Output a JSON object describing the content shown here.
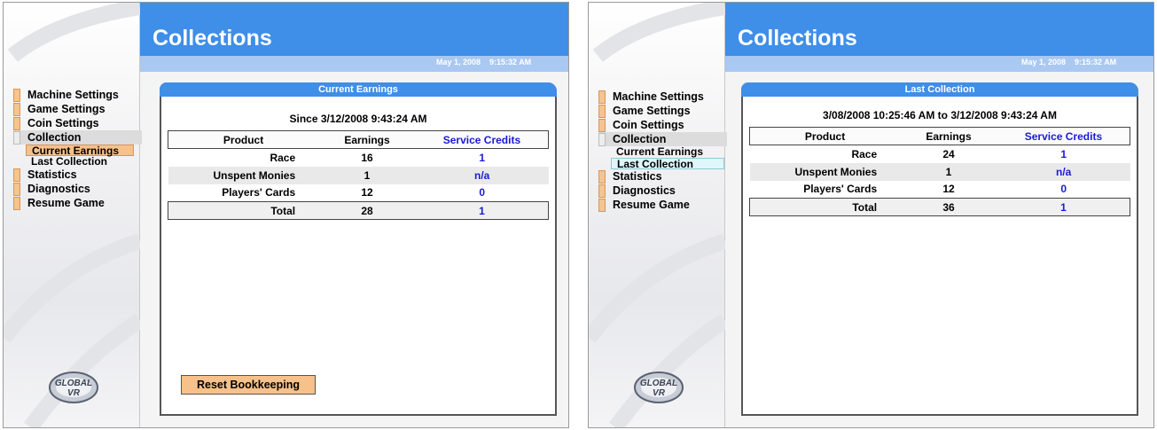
{
  "screens": [
    {
      "title": "Collections",
      "date": "May 1, 2008",
      "time": "9:15:32 AM",
      "menu": {
        "machine_settings": "Machine Settings",
        "game_settings": "Game Settings",
        "coin_settings": "Coin Settings",
        "collection": "Collection",
        "current_earnings": "Current Earnings",
        "last_collection": "Last Collection",
        "statistics": "Statistics",
        "diagnostics": "Diagnostics",
        "resume_game": "Resume Game"
      },
      "panel": {
        "title": "Current Earnings",
        "subtitle": "Since 3/12/2008 9:43:24 AM",
        "headers": {
          "product": "Product",
          "earnings": "Earnings",
          "service_credits": "Service Credits"
        },
        "rows": [
          {
            "product": "Race",
            "earnings": "16",
            "service_credits": "1"
          },
          {
            "product": "Unspent Monies",
            "earnings": "1",
            "service_credits": "n/a"
          },
          {
            "product": "Players' Cards",
            "earnings": "12",
            "service_credits": "0"
          }
        ],
        "total": {
          "product": "Total",
          "earnings": "28",
          "service_credits": "1"
        },
        "reset_button": "Reset Bookkeeping"
      },
      "logo_text": "GLOBAL VR"
    },
    {
      "title": "Collections",
      "date": "May 1, 2008",
      "time": "9:15:32 AM",
      "menu": {
        "machine_settings": "Machine Settings",
        "game_settings": "Game Settings",
        "coin_settings": "Coin Settings",
        "collection": "Collection",
        "current_earnings": "Current Earnings",
        "last_collection": "Last Collection",
        "statistics": "Statistics",
        "diagnostics": "Diagnostics",
        "resume_game": "Resume Game"
      },
      "panel": {
        "title": "Last Collection",
        "subtitle": "3/08/2008 10:25:46 AM to 3/12/2008 9:43:24 AM",
        "headers": {
          "product": "Product",
          "earnings": "Earnings",
          "service_credits": "Service Credits"
        },
        "rows": [
          {
            "product": "Race",
            "earnings": "24",
            "service_credits": "1"
          },
          {
            "product": "Unspent Monies",
            "earnings": "1",
            "service_credits": "n/a"
          },
          {
            "product": "Players' Cards",
            "earnings": "12",
            "service_credits": "0"
          }
        ],
        "total": {
          "product": "Total",
          "earnings": "36",
          "service_credits": "1"
        }
      },
      "logo_text": "GLOBAL VR"
    }
  ],
  "colors": {
    "header_blue": "#3f8ee8",
    "datebar_blue": "#a9c8f2",
    "menu_tab_orange": "#f5c48f",
    "service_credit_blue": "#1a1ad6",
    "selection_orange": "#f6c18a",
    "selection_cyan": "#dff6fb"
  },
  "icons": [
    "menu-tab-icon",
    "collection-expanded-icon",
    "global-vr-logo"
  ]
}
